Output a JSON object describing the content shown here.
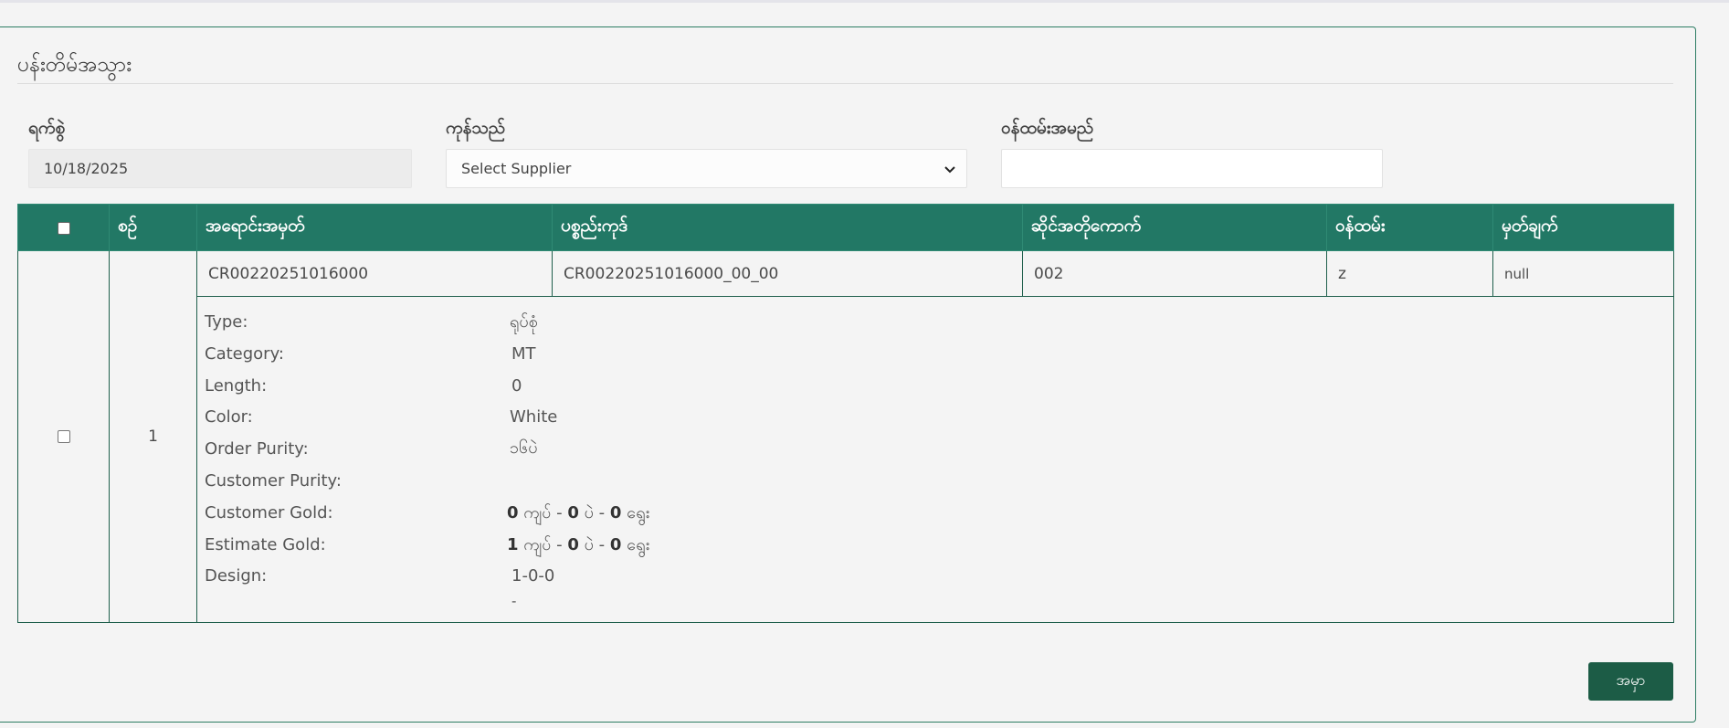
{
  "page_title": "ပန်းတိမ်အသွား",
  "form": {
    "date_label": "ရက်စွဲ",
    "date_value": "10/18/2025",
    "supplier_label": "ကုန်သည်",
    "supplier_selected": "Select Supplier",
    "staff_label": "ဝန်ထမ်းအမည်",
    "staff_value": ""
  },
  "table": {
    "headers": [
      "စဉ်",
      "အရောင်းအမှတ်",
      "ပစ္စည်းကုဒ်",
      "ဆိုင်အတိုကောက်",
      "ဝန်ထမ်း",
      "မှတ်ချက်"
    ],
    "rows": [
      {
        "no": "1",
        "sale_no": "CR00220251016000",
        "item_code": "CR00220251016000_00_00",
        "shop_abbr": "002",
        "staff": "z",
        "remark": "null",
        "details": {
          "type_label": "Type:",
          "type_value": "ရုပ်စုံ",
          "category_label": "Category:",
          "category_value": "MT",
          "length_label": "Length:",
          "length_value": "0",
          "color_label": "Color:",
          "color_value": "White",
          "order_purity_label": "Order Purity:",
          "order_purity_value": "၁၆ပဲ",
          "customer_purity_label": "Customer Purity:",
          "customer_purity_value": "",
          "customer_gold_label": "Customer Gold:",
          "customer_gold": {
            "kyat": "0",
            "pe": "0",
            "ywe": "0"
          },
          "estimate_gold_label": "Estimate Gold:",
          "estimate_gold": {
            "kyat": "1",
            "pe": "0",
            "ywe": "0"
          },
          "design_label": "Design:",
          "design_value": "1-0-0",
          "design_note": "-"
        }
      }
    ]
  },
  "units": {
    "kyat": "ကျပ်",
    "pe": "ပဲ",
    "ywe": "ရွေး",
    "sep": "-"
  },
  "actions": {
    "submit_label": "အမှာ"
  },
  "colors": {
    "header_bg": "#227865",
    "button_bg": "#1c5c46",
    "border": "#1f5f4c"
  }
}
